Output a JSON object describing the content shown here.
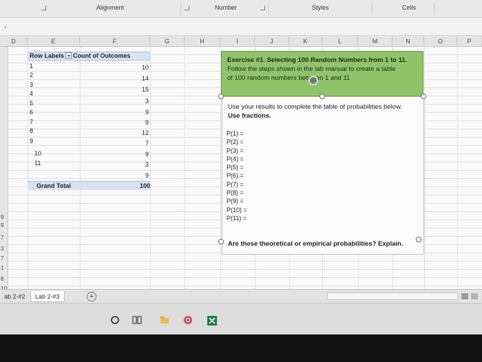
{
  "ribbon": {
    "groups": [
      "Alignment",
      "Number",
      "Styles",
      "Cells"
    ]
  },
  "columns": [
    "D",
    "E",
    "F",
    "G",
    "H",
    "I",
    "J",
    "K",
    "L",
    "M",
    "N",
    "O",
    "P"
  ],
  "row_numbers_left": [
    "9",
    "9",
    "7",
    "3",
    "7",
    "1",
    "8",
    "10"
  ],
  "pivot": {
    "header_label": "Row Labels",
    "header_value": "Count of Outcomes",
    "rows": [
      {
        "label": "1",
        "value": "10"
      },
      {
        "label": "2",
        "value": "14"
      },
      {
        "label": "3",
        "value": "15"
      },
      {
        "label": "4",
        "value": "3"
      },
      {
        "label": "5",
        "value": "9"
      },
      {
        "label": "6",
        "value": "9"
      },
      {
        "label": "7",
        "value": "12"
      },
      {
        "label": "8",
        "value": "7"
      },
      {
        "label": "9",
        "value": "9"
      },
      {
        "label": "10",
        "value": "3"
      },
      {
        "label": "11",
        "value": "9"
      }
    ],
    "total_label": "Grand Total",
    "total_value": "100"
  },
  "exercise": {
    "line1": "Exercise #1. Selecting 100 Random Numbers from 1 to 11.",
    "line2": "Follow the steps shown in the lab manual to create a table",
    "line3": "of 100 random numbers between 1 and 11"
  },
  "instructions": {
    "line1": "Use your results to complete the table of probabilities below.",
    "line2": "Use fractions."
  },
  "probabilities": [
    "P(1) =",
    "P(2) =",
    "P(3) =",
    "P(4) =",
    "P(5) =",
    "P(6) =",
    "P(7) =",
    "P(8) =",
    "P(9) =",
    "P(10) =",
    "P(11) ="
  ],
  "question": "Are these theoretical or empirical probabilities? Explain.",
  "tabs": {
    "tab1": "ab 2-#2",
    "tab2": "Lab 2-#3",
    "add": "+"
  },
  "colors": {
    "exercise_fill": "#8fc46a",
    "pivot_header": "#d6e3f2"
  }
}
